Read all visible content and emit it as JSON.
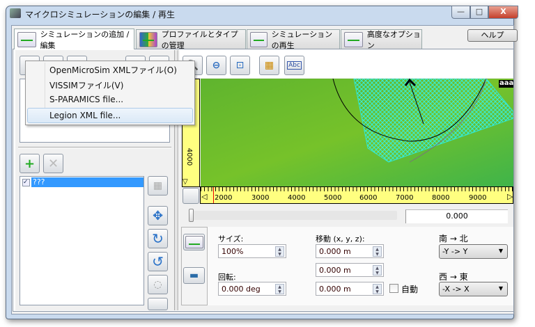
{
  "window": {
    "title": "マイクロシミュレーションの編集 / 再生",
    "minimize": "—",
    "maximize": "□",
    "close": "X"
  },
  "tabs": [
    {
      "label": "シミュレーションの追加 / 編集",
      "active": true
    },
    {
      "label": "プロファイルとタイプの管理"
    },
    {
      "label": "シミュレーションの再生"
    },
    {
      "label": "高度なオプション"
    }
  ],
  "help_button": "ヘルプ",
  "file_menu": {
    "items": [
      "OpenMicroSim XMLファイル(O)",
      "VISSIMファイル(V)",
      "S-PARAMICS file...",
      "Legion XML file..."
    ],
    "highlighted": 3
  },
  "simulation_list": {
    "items": [
      {
        "label": "???",
        "checked": true,
        "selected": true
      }
    ]
  },
  "map": {
    "corner_label": "aaa",
    "abc_button": "Abc",
    "vertical_ruler_label": "4000",
    "x_ticks": [
      "2000",
      "3000",
      "4000",
      "5000",
      "6000",
      "7000",
      "8000",
      "9000"
    ]
  },
  "time": {
    "value": "0.000",
    "slider_fraction": 0
  },
  "properties": {
    "size_label": "サイズ:",
    "size_value": "100%",
    "rotation_label": "回転:",
    "rotation_value": "0.000 deg",
    "move_label": "移動 (x, y, z):",
    "move_x": "0.000 m",
    "move_y": "0.000 m",
    "move_z": "0.000 m",
    "auto_label": "自動",
    "auto_checked": false,
    "south_north_label": "南 → 北",
    "south_north_value": "-Y -> Y",
    "west_east_label": "西 → 東",
    "west_east_value": "-X -> X"
  },
  "colors": {
    "accent": "#3399ff",
    "map_green": "#6cc12e",
    "ruler": "#ffff80",
    "hatch": "#2ee8d8"
  }
}
